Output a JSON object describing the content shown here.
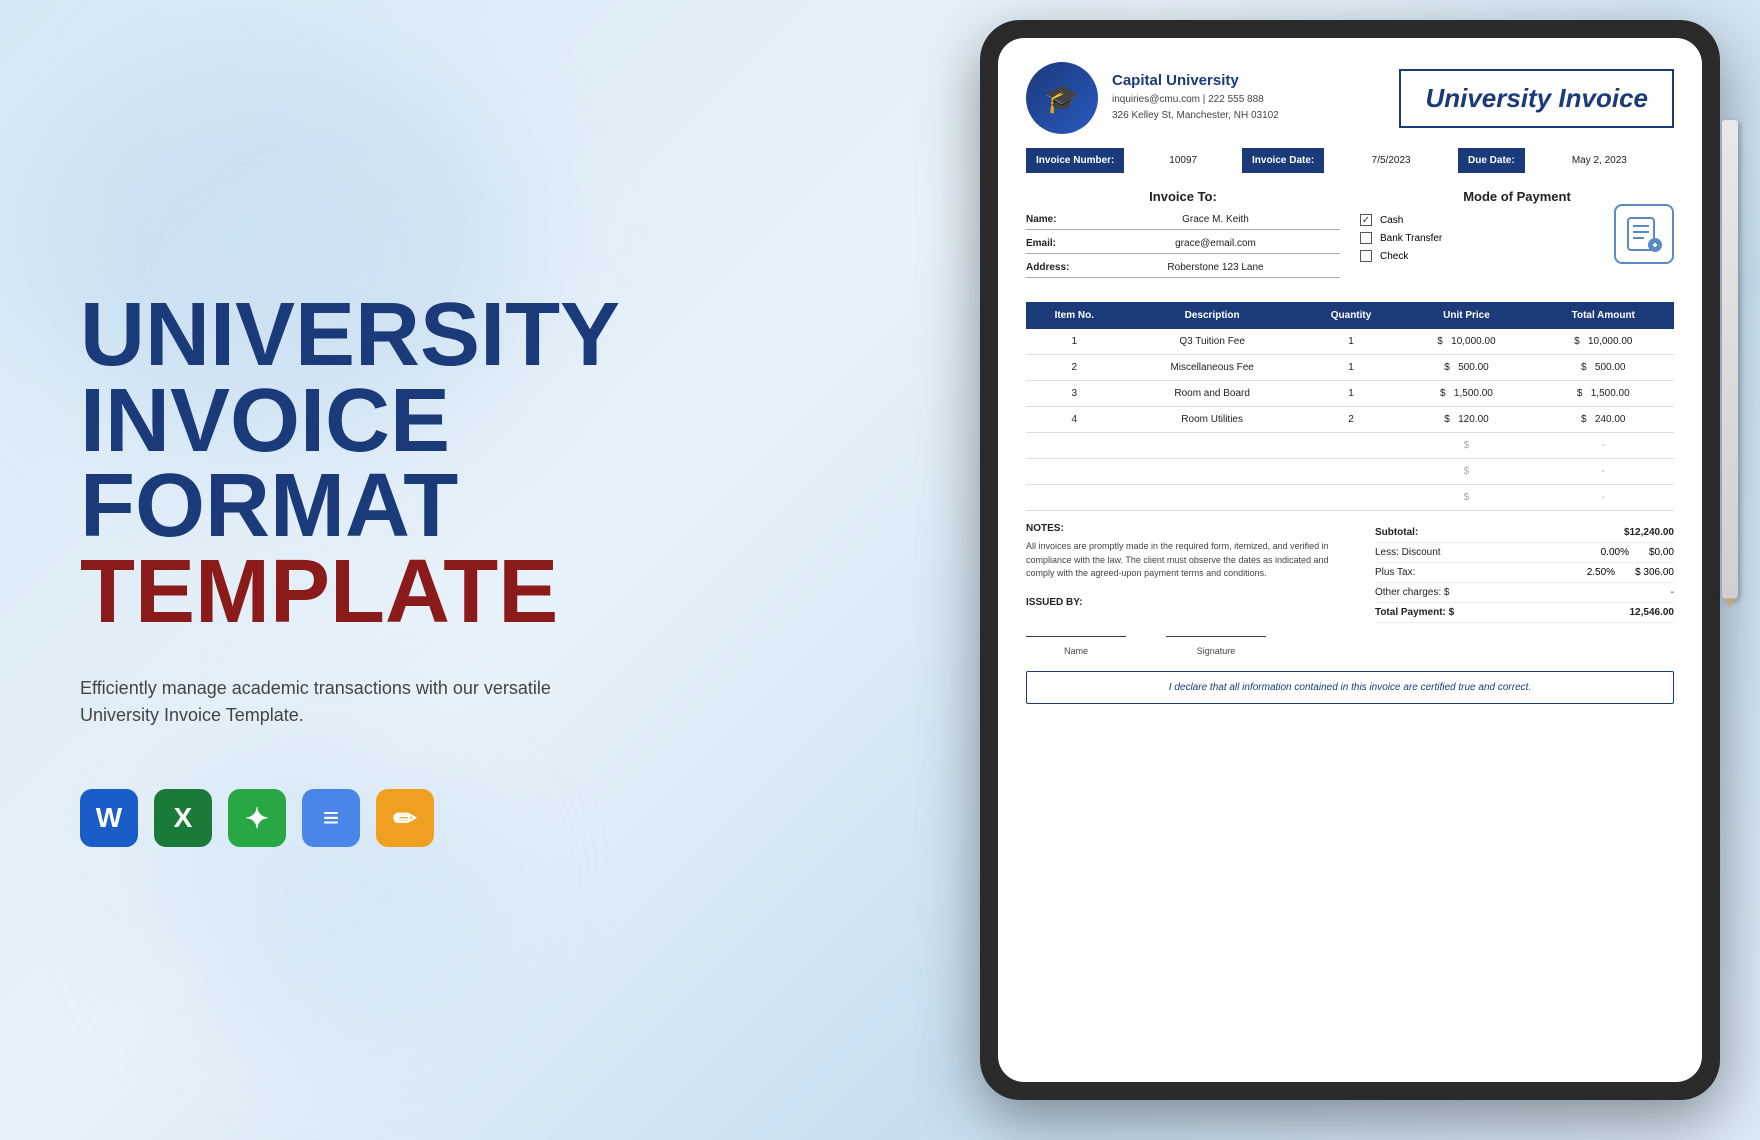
{
  "left": {
    "title_line1": "UNIVERSITY",
    "title_line2": "INVOICE",
    "title_line3": "FORMAT",
    "title_line4": "TEMPLATE",
    "subtitle": "Efficiently manage academic transactions with our versatile University Invoice Template.",
    "icons": [
      {
        "name": "Word",
        "letter": "W",
        "class": "icon-word"
      },
      {
        "name": "Excel",
        "letter": "X",
        "class": "icon-excel"
      },
      {
        "name": "Sheets",
        "letter": "✦",
        "class": "icon-sheets"
      },
      {
        "name": "Docs",
        "letter": "≡",
        "class": "icon-docs"
      },
      {
        "name": "Pages",
        "letter": "✏",
        "class": "icon-pages"
      }
    ]
  },
  "invoice": {
    "university_name": "Capital University",
    "university_email": "inquiries@cmu.com | 222 555 888",
    "university_address": "326 Kelley St, Manchester, NH 03102",
    "title": "University Invoice",
    "invoice_number_label": "Invoice Number:",
    "invoice_number": "10097",
    "invoice_date_label": "Invoice Date:",
    "invoice_date": "7/5/2023",
    "due_date_label": "Due Date:",
    "due_date": "May 2, 2023",
    "invoice_to_heading": "Invoice To:",
    "fields": [
      {
        "label": "Name:",
        "value": "Grace M. Keith"
      },
      {
        "label": "Email:",
        "value": "grace@email.com"
      },
      {
        "label": "Address:",
        "value": "Roberstone 123 Lane"
      }
    ],
    "payment_heading": "Mode of Payment",
    "payment_options": [
      {
        "label": "Cash",
        "checked": true
      },
      {
        "label": "Bank Transfer",
        "checked": false
      },
      {
        "label": "Check",
        "checked": false
      }
    ],
    "table": {
      "headers": [
        "Item No.",
        "Description",
        "Quantity",
        "Unit Price",
        "Total Amount"
      ],
      "rows": [
        {
          "item": "1",
          "description": "Q3 Tuition Fee",
          "quantity": "1",
          "unit_price": "$ 10,000.00",
          "total": "$ 10,000.00"
        },
        {
          "item": "2",
          "description": "Miscellaneous Fee",
          "quantity": "1",
          "unit_price": "$ 500.00",
          "total": "$ 500.00"
        },
        {
          "item": "3",
          "description": "Room and Board",
          "quantity": "1",
          "unit_price": "$ 1,500.00",
          "total": "$ 1,500.00"
        },
        {
          "item": "4",
          "description": "Room Utilities",
          "quantity": "2",
          "unit_price": "$ 120.00",
          "total": "$ 240.00"
        },
        {
          "item": "",
          "description": "",
          "quantity": "",
          "unit_price": "$",
          "total": "-"
        },
        {
          "item": "",
          "description": "",
          "quantity": "",
          "unit_price": "$",
          "total": "-"
        },
        {
          "item": "",
          "description": "",
          "quantity": "",
          "unit_price": "$",
          "total": "-"
        }
      ]
    },
    "notes_label": "NOTES:",
    "notes_text": "All invoices are promptly made in the required form, itemized, and verified in compliance with the law. The client must observe the dates as indicated and comply with the agreed-upon payment terms and conditions.",
    "issued_by_label": "ISSUED BY:",
    "name_label": "Name",
    "signature_label": "Signature",
    "subtotal_label": "Subtotal:",
    "subtotal_value": "$12,240.00",
    "discount_label": "Less: Discount",
    "discount_pct": "0.00%",
    "discount_value": "$0.00",
    "tax_label": "Plus Tax:",
    "tax_pct": "2.50%",
    "tax_value": "$ 306.00",
    "other_label": "Other charges: $",
    "other_value": "-",
    "total_label": "Total Payment: $",
    "total_value": "12,546.00",
    "declaration": "I declare that all information contained in this invoice are certified true and correct."
  }
}
